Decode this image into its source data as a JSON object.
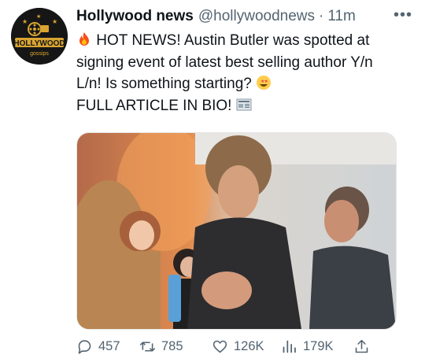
{
  "tweet": {
    "display_name": "Hollywood news",
    "handle": "@hollywoodnews",
    "separator": "·",
    "time": "11m",
    "more_label": "•••",
    "text_lines": [
      "HOT NEWS! Austin Butler was spotted at",
      "signing event of latest best selling author Y/n",
      "L/n! Is something starting?",
      "FULL ARTICLE IN BIO!"
    ]
  },
  "avatar": {
    "logo_text": "HOLLYWOOD",
    "logo_subtext": "gossips",
    "colors": {
      "background": "#161616",
      "gold": "#d9a531"
    }
  },
  "media": {
    "description_icon": "photo",
    "colors": {
      "accent": "#e07a3a"
    }
  },
  "actions": {
    "reply_count": "457",
    "retweet_count": "785",
    "like_count": "126K",
    "views_count": "179K"
  },
  "icons": {
    "fire": "fire-icon",
    "star_eyes": "star-struck-emoji",
    "newspaper": "newspaper-emoji",
    "reply": "reply-icon",
    "retweet": "retweet-icon",
    "like": "heart-icon",
    "views": "views-icon",
    "share": "share-icon"
  },
  "colors": {
    "text": "#0f1419",
    "secondary": "#536471"
  }
}
